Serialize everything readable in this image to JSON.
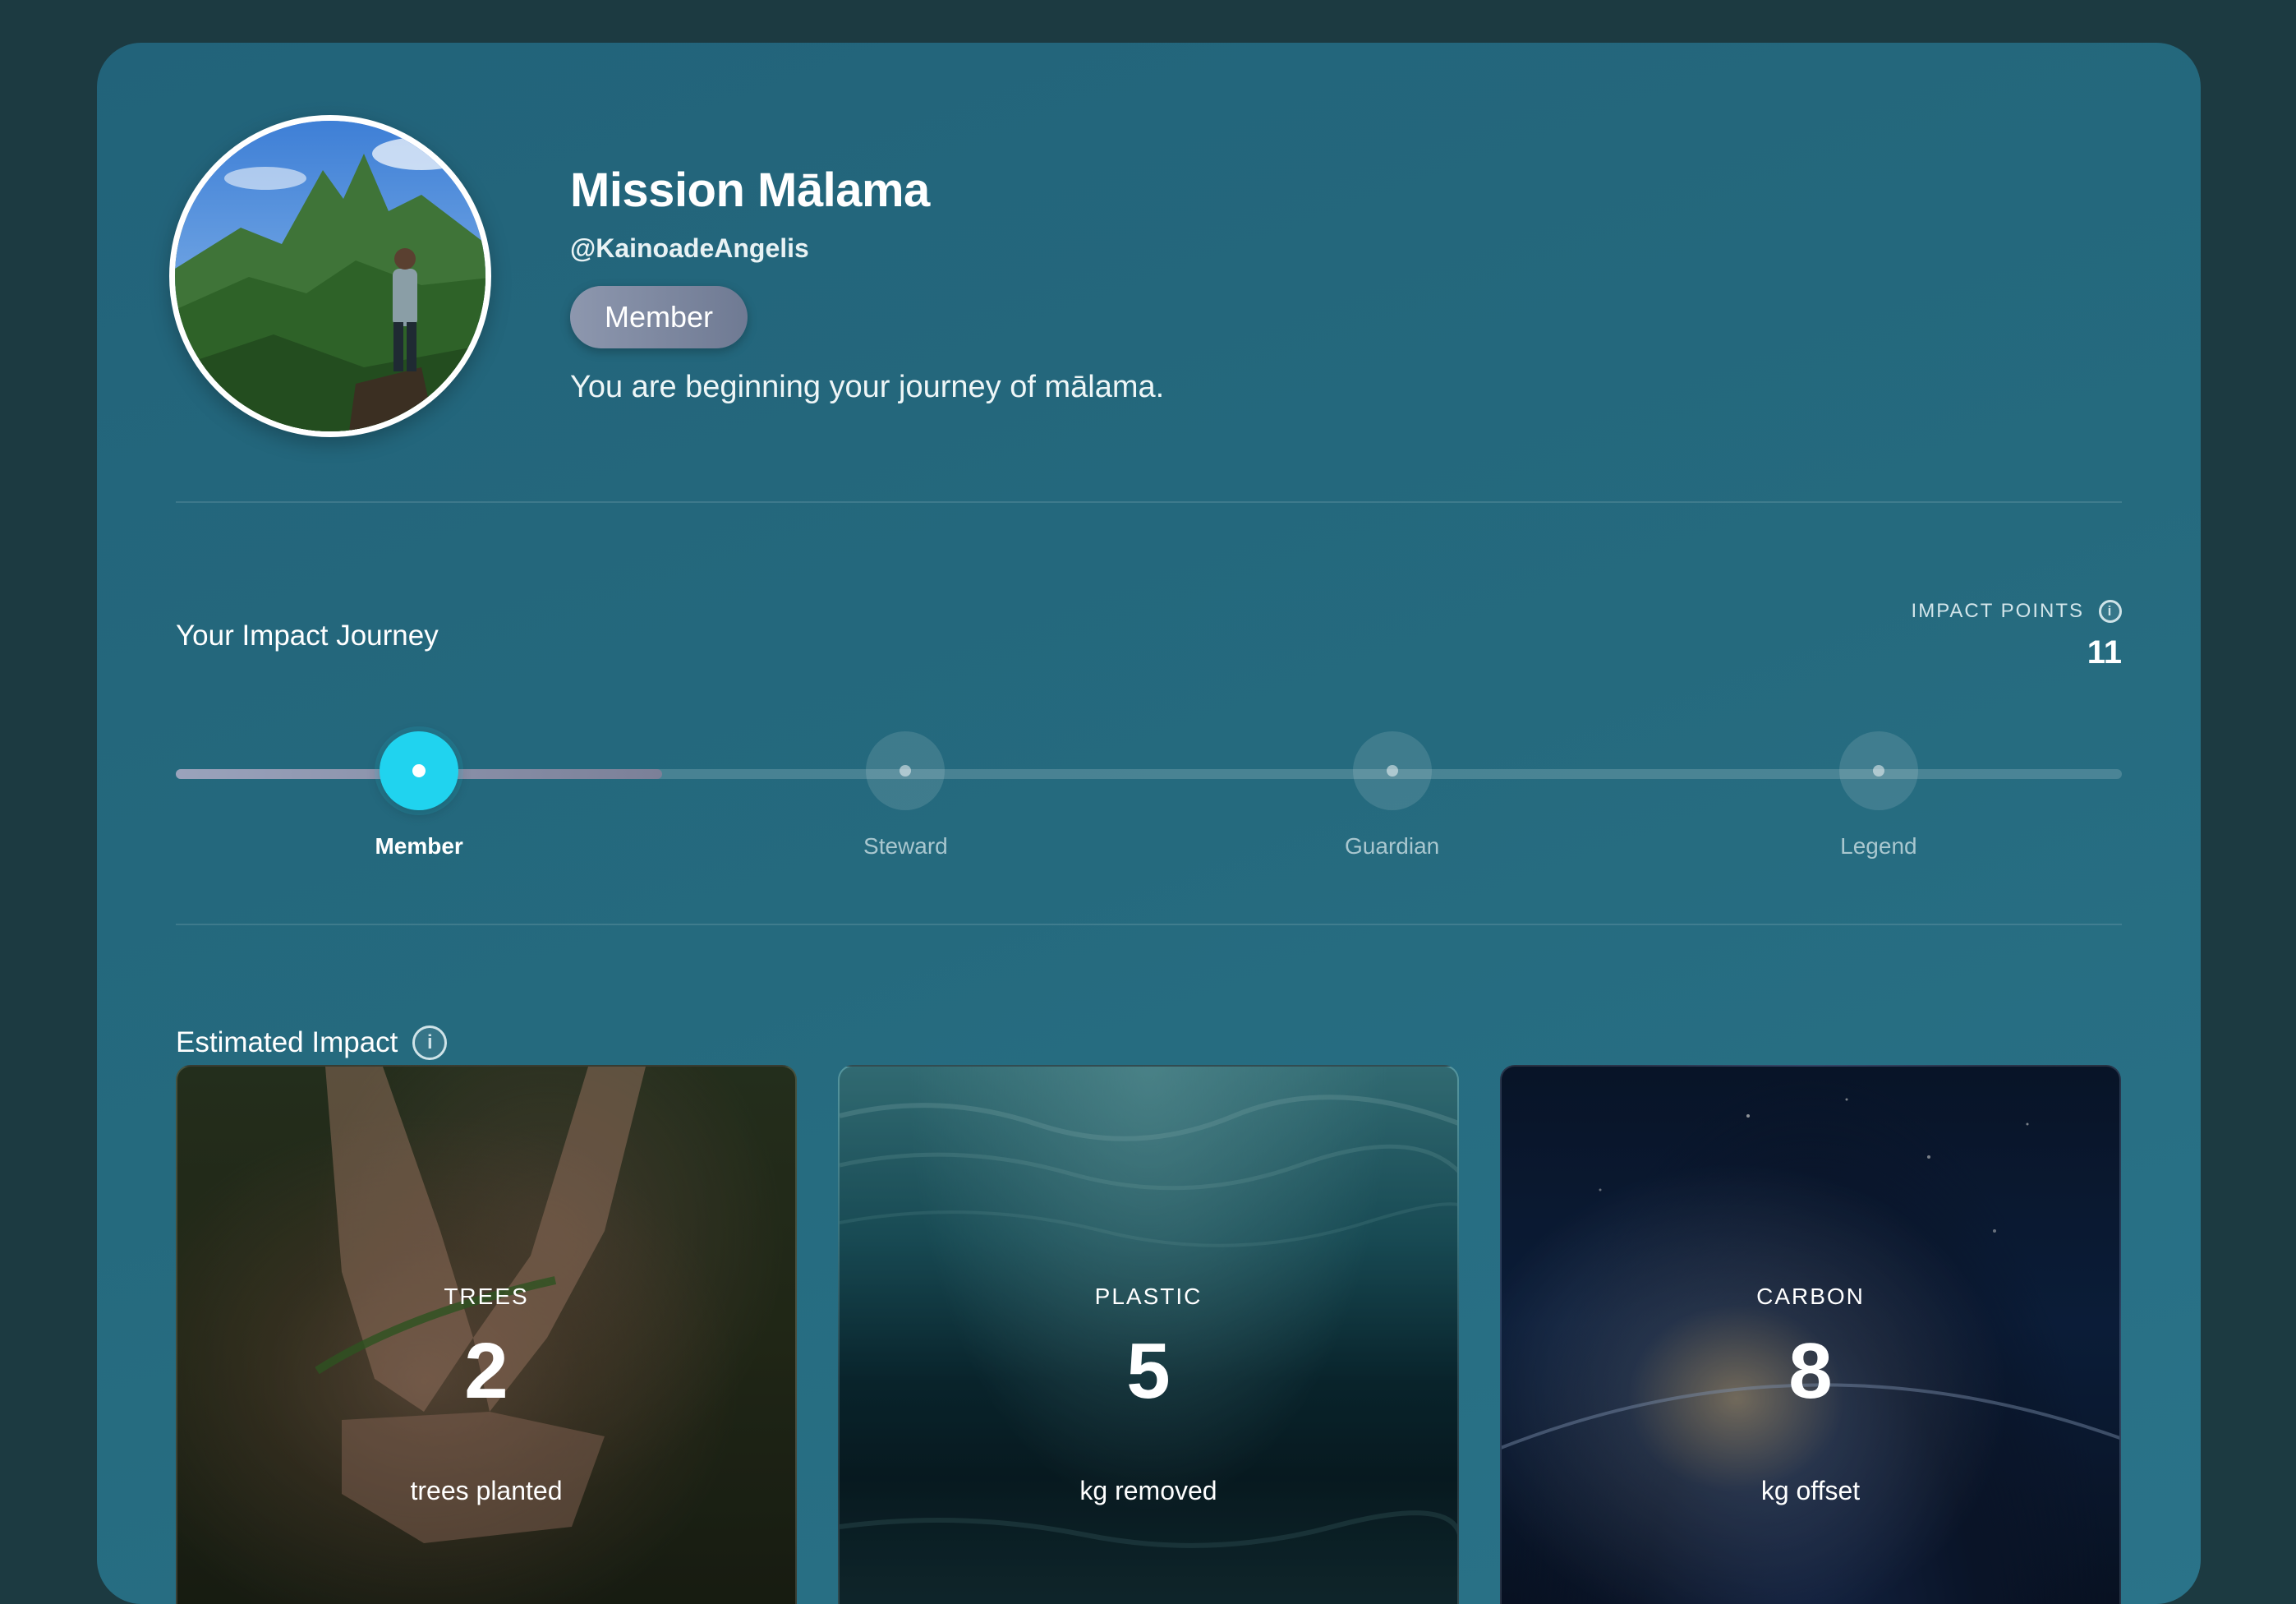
{
  "profile": {
    "name": "Mission Mālama",
    "handle": "@KainoadeAngelis",
    "tier": "Member",
    "message": "You are beginning your journey of mālama.",
    "avatar_icon": "profile-photo"
  },
  "journey": {
    "title": "Your Impact Journey",
    "points_label": "IMPACT POINTS",
    "points_value": "11",
    "progress_fraction": 0.25,
    "current_milestone": 0,
    "milestones": [
      {
        "label": "Member"
      },
      {
        "label": "Steward"
      },
      {
        "label": "Guardian"
      },
      {
        "label": "Legend"
      }
    ]
  },
  "impact": {
    "title": "Estimated Impact",
    "cards": [
      {
        "label": "TREES",
        "value": "2",
        "unit": "trees planted"
      },
      {
        "label": "PLASTIC",
        "value": "5",
        "unit": "kg removed"
      },
      {
        "label": "CARBON",
        "value": "8",
        "unit": "kg offset"
      }
    ]
  },
  "colors": {
    "page_background": "#1c3a41",
    "panel": "#256a7e",
    "accent": "#20d3ef",
    "badge": "#7c869e"
  },
  "icons": {
    "info": "info-circle-icon"
  }
}
